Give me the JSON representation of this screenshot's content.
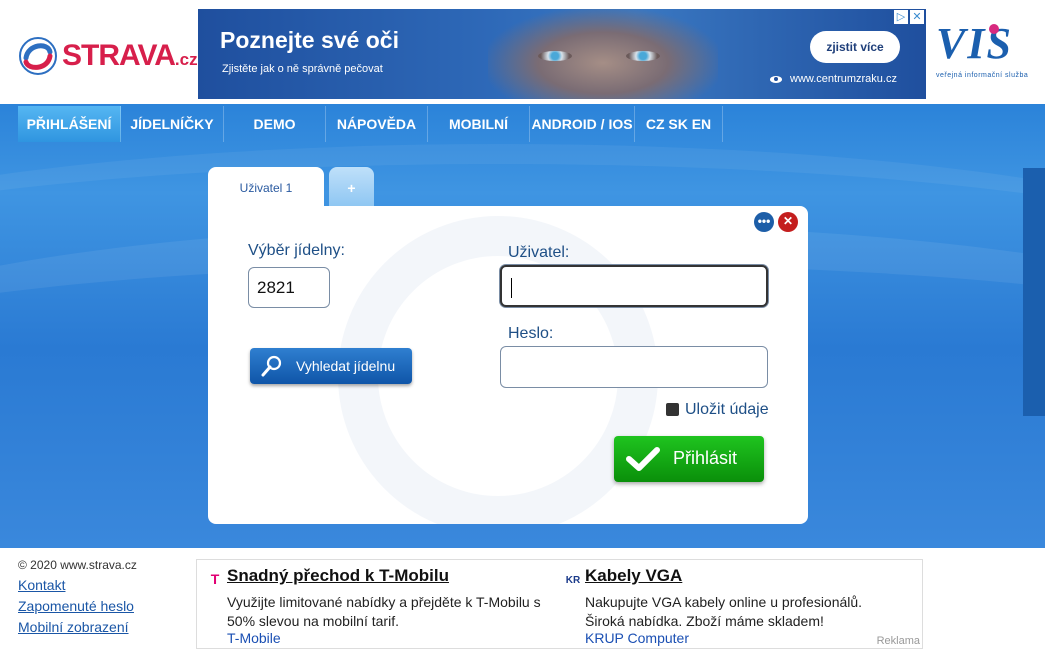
{
  "brand": {
    "name": "STRAVA",
    "tld": ".cz"
  },
  "top_ad": {
    "title": "Poznejte své oči",
    "subtitle": "Zjistěte jak o ně správně pečovat",
    "cta": "zjistit více",
    "url": "www.centrumzraku.cz",
    "choice_icons": [
      "▷",
      "✕"
    ]
  },
  "partner_logo": {
    "text": "VIS",
    "subtitle": "veřejná informační služba"
  },
  "nav": {
    "items": [
      {
        "label": "PŘIHLÁŠENÍ",
        "active": true
      },
      {
        "label": "JÍDELNÍČKY",
        "active": false
      },
      {
        "label": "DEMO",
        "active": false
      },
      {
        "label": "NÁPOVĚDA",
        "active": false
      },
      {
        "label": "MOBILNÍ",
        "active": false
      },
      {
        "label": "ANDROID / IOS",
        "active": false
      },
      {
        "label": "CZ SK EN",
        "active": false
      }
    ]
  },
  "tabs": [
    {
      "label": "Uživatel 1"
    },
    {
      "label": "+"
    }
  ],
  "login": {
    "canteen_label": "Výběr jídelny:",
    "canteen_value": "2821",
    "search_button": "Vyhledat jídelnu",
    "user_label": "Uživatel:",
    "user_value": "",
    "password_label": "Heslo:",
    "password_value": "",
    "remember_label": "Uložit údaje",
    "remember_checked": false,
    "submit_label": "Přihlásit",
    "more_icon": "•••",
    "close_icon": "✕"
  },
  "footer": {
    "copyright": "© 2020 www.strava.cz",
    "links": [
      "Kontakt",
      "Zapomenuté heslo",
      "Mobilní zobrazení"
    ]
  },
  "footer_ads": [
    {
      "logo": "T",
      "title": "Snadný přechod k T-Mobilu",
      "text": "Využijte limitované nabídky a přejděte k T-Mobilu s 50% slevou na mobilní tarif.",
      "source": "T-Mobile"
    },
    {
      "logo": "KR",
      "title": "Kabely VGA",
      "text": "Nakupujte VGA kabely online u profesionálů. Široká nabídka. Zboží máme skladem!",
      "source": "KRUP Computer"
    }
  ],
  "ads_label": "Reklama",
  "colors": {
    "brand_red": "#d71f4b",
    "nav_blue": "#2b83d9",
    "login_green": "#0fa80f",
    "close_red": "#c41e1e"
  }
}
